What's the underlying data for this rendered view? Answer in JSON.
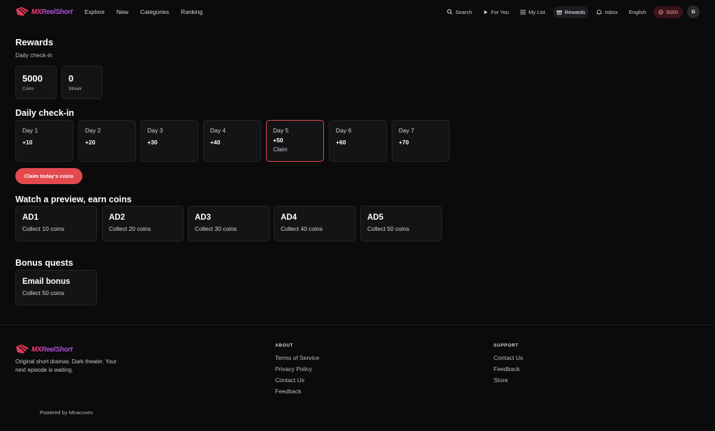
{
  "brand": {
    "name_a": "MX",
    "name_b": "ReelShort"
  },
  "nav": {
    "explore": "Explore",
    "new": "New",
    "categories": "Categories",
    "ranking": "Ranking",
    "search": "Search",
    "for_you": "For You",
    "my_list": "My List",
    "rewards": "Rewards",
    "inbox": "Inbox",
    "language": "English",
    "coins": "5000",
    "avatar_initial": "G"
  },
  "page": {
    "title": "Rewards",
    "subtitle": "Daily check-in",
    "stats": [
      {
        "value": "5000",
        "label": "Coins"
      },
      {
        "value": "0",
        "label": "Streak"
      }
    ]
  },
  "checkin": {
    "heading": "Daily check-in",
    "days": [
      {
        "label": "Day 1",
        "reward": "+10"
      },
      {
        "label": "Day 2",
        "reward": "+20"
      },
      {
        "label": "Day 3",
        "reward": "+30"
      },
      {
        "label": "Day 4",
        "reward": "+40"
      },
      {
        "label": "Day 5",
        "reward": "+50",
        "action": "Claim"
      },
      {
        "label": "Day 6",
        "reward": "+60"
      },
      {
        "label": "Day 7",
        "reward": "+70"
      }
    ],
    "claim_button": "Claim today's coins"
  },
  "ads": {
    "heading": "Watch a preview, earn coins",
    "items": [
      {
        "title": "AD1",
        "subtitle": "Collect 10 coins"
      },
      {
        "title": "AD2",
        "subtitle": "Collect 20 coins"
      },
      {
        "title": "AD3",
        "subtitle": "Collect 30 coins"
      },
      {
        "title": "AD4",
        "subtitle": "Collect 40 coins"
      },
      {
        "title": "AD5",
        "subtitle": "Collect 50 coins"
      }
    ]
  },
  "quests": {
    "heading": "Bonus quests",
    "items": [
      {
        "title": "Email bonus",
        "subtitle": "Collect 50 coins"
      }
    ]
  },
  "footer": {
    "description": "Original short dramas. Dark theater. Your next episode is waiting.",
    "about_heading": "ABOUT",
    "about_links": [
      "Terms of Service",
      "Privacy Policy",
      "Contact Us",
      "Feedback"
    ],
    "support_heading": "SUPPORT",
    "support_links": [
      "Contact Us",
      "Feedback",
      "Store"
    ],
    "powered": "Powered by Miracuves"
  },
  "colors": {
    "accent": "#e34a4e",
    "background": "#0b0b0c",
    "card": "#141417",
    "brand_pink": "#f0437a",
    "brand_purple": "#b04ed6"
  }
}
